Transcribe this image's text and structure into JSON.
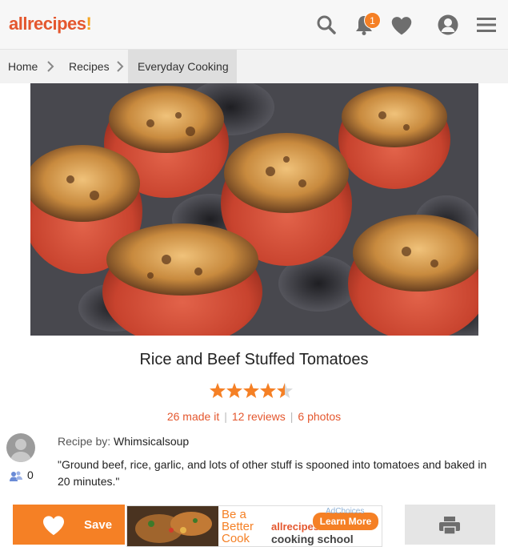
{
  "header": {
    "logo_main": "allrecipes",
    "logo_bang": "!",
    "notification_count": "1",
    "icons": [
      "search-icon",
      "bell-icon",
      "heart-icon",
      "user-icon",
      "menu-icon"
    ]
  },
  "breadcrumbs": [
    "Home",
    "Recipes",
    "Everyday Cooking"
  ],
  "recipe": {
    "title": "Rice and Beef Stuffed Tomatoes",
    "rating": 4.5,
    "made_it": "26 made it",
    "reviews": "12 reviews",
    "photos": "6 photos",
    "author_label": "Recipe by:",
    "author": "Whimsicalsoup",
    "followers": "0",
    "description": "\"Ground beef, rice, garlic, and lots of other stuff is spooned into tomatoes and baked in 20 minutes.\""
  },
  "actions": {
    "save_label": "Save"
  },
  "ad": {
    "headline": "Be a Better Cook",
    "brand": "allrecipes!",
    "product": "cooking school",
    "cta": "Learn More",
    "choices": "AdChoices"
  },
  "colors": {
    "brand": "#e4572e",
    "accent": "#f58025",
    "star": "#f58025"
  }
}
